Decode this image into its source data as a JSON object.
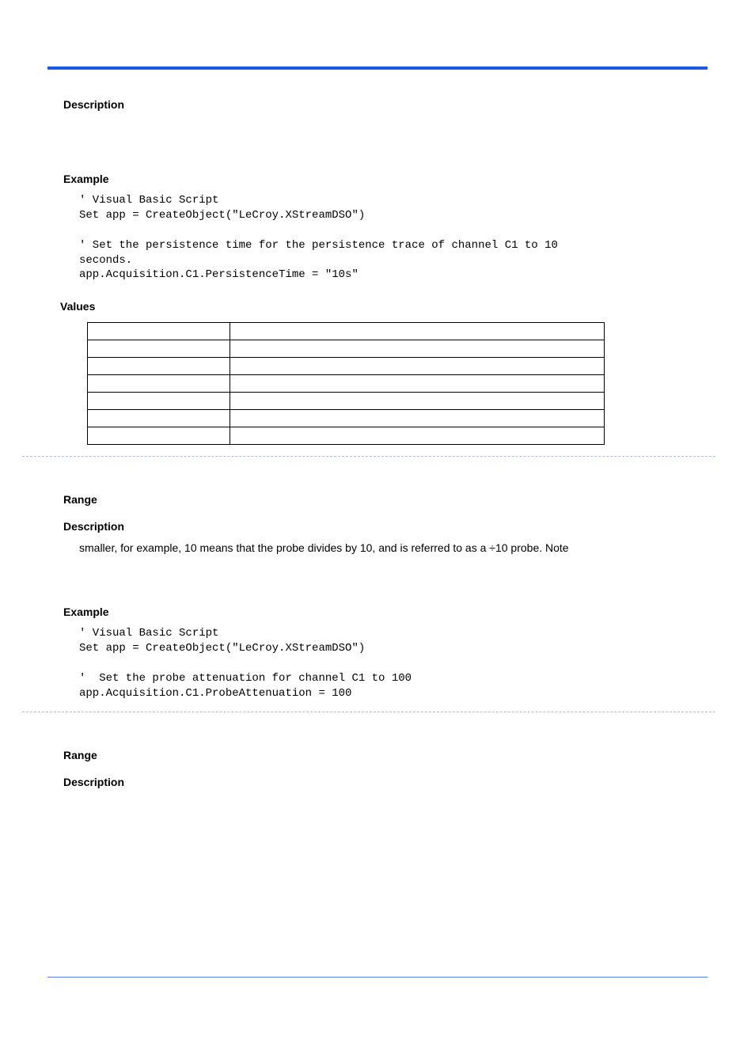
{
  "section1": {
    "description_heading": "Description",
    "example_heading": "Example",
    "code_lines": [
      "' Visual Basic Script",
      "Set app = CreateObject(\"LeCroy.XStreamDSO\")",
      "",
      "' Set the persistence time for the persistence trace of channel C1 to 10 ",
      "seconds.",
      "app.Acquisition.C1.PersistenceTime = \"10s\""
    ],
    "values_heading": "Values"
  },
  "section2": {
    "range_heading": "Range",
    "description_heading": "Description",
    "description_body": "smaller, for example, 10 means that the probe divides by 10, and is referred to as a ÷10 probe. Note",
    "example_heading": "Example",
    "code_lines": [
      "' Visual Basic Script",
      "Set app = CreateObject(\"LeCroy.XStreamDSO\")",
      "",
      "'  Set the probe attenuation for channel C1 to 100",
      "app.Acquisition.C1.ProbeAttenuation = 100"
    ]
  },
  "section3": {
    "range_heading": "Range",
    "description_heading": "Description"
  }
}
